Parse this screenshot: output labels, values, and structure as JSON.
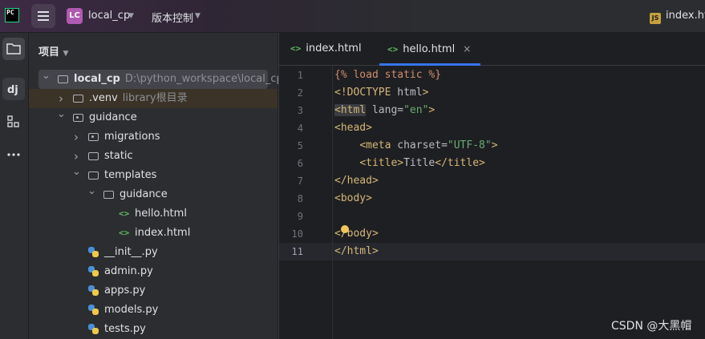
{
  "app": {
    "logo_text": "PC",
    "project_badge": "LC",
    "project_name": "local_cp",
    "vcs_label": "版本控制",
    "run_file": "index.htm"
  },
  "project_panel": {
    "title": "项目",
    "tree": [
      {
        "label": "local_cp",
        "hint": "D:\\python_workspace\\local_cp",
        "type": "folder",
        "expanded": true
      },
      {
        "label": ".venv",
        "hint": "library根目录",
        "type": "folder",
        "expanded": false
      },
      {
        "label": "guidance",
        "hint": "",
        "type": "folder-dot",
        "expanded": true
      },
      {
        "label": "migrations",
        "hint": "",
        "type": "folder-dot",
        "expanded": false
      },
      {
        "label": "static",
        "hint": "",
        "type": "folder",
        "expanded": false
      },
      {
        "label": "templates",
        "hint": "",
        "type": "folder",
        "expanded": true
      },
      {
        "label": "guidance",
        "hint": "",
        "type": "folder",
        "expanded": true
      },
      {
        "label": "hello.html",
        "hint": "",
        "type": "html"
      },
      {
        "label": "index.html",
        "hint": "",
        "type": "html"
      },
      {
        "label": "__init__.py",
        "hint": "",
        "type": "py"
      },
      {
        "label": "admin.py",
        "hint": "",
        "type": "py"
      },
      {
        "label": "apps.py",
        "hint": "",
        "type": "py"
      },
      {
        "label": "models.py",
        "hint": "",
        "type": "py"
      },
      {
        "label": "tests.py",
        "hint": "",
        "type": "py"
      }
    ]
  },
  "editor": {
    "tabs": [
      {
        "label": "index.html",
        "active": false
      },
      {
        "label": "hello.html",
        "active": true
      }
    ],
    "close_glyph": "×",
    "current_line": 11,
    "lines": [
      {
        "n": "1",
        "text": "{% load static %}"
      },
      {
        "n": "2",
        "text": "<!DOCTYPE html>"
      },
      {
        "n": "3",
        "text": "<html lang=\"en\">"
      },
      {
        "n": "4",
        "text": "<head>"
      },
      {
        "n": "5",
        "text": "    <meta charset=\"UTF-8\">"
      },
      {
        "n": "6",
        "text": "    <title>Title</title>"
      },
      {
        "n": "7",
        "text": "</head>"
      },
      {
        "n": "8",
        "text": "<body>"
      },
      {
        "n": "9",
        "text": ""
      },
      {
        "n": "10",
        "text": "</body>"
      },
      {
        "n": "11",
        "text": "</html>"
      }
    ]
  },
  "watermark": "CSDN @大黑帽",
  "colors": {
    "accent": "#3574f0",
    "tag": "#d5b778",
    "string": "#6aab73",
    "html_icon": "#5fb85f",
    "badge": "#b05ab3"
  }
}
